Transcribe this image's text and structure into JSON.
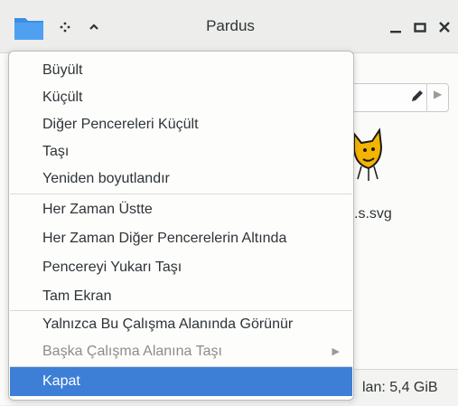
{
  "window": {
    "title": "Pardus"
  },
  "background": {
    "filename_partial": ".s.svg",
    "status_partial": "lan: 5,4 GiB"
  },
  "menu": {
    "items": [
      {
        "label": "Büyült"
      },
      {
        "label": "Küçült"
      },
      {
        "label": "Diğer Pencereleri Küçült"
      },
      {
        "label": "Taşı"
      },
      {
        "label": "Yeniden boyutlandır"
      },
      {
        "label": "Her Zaman Üstte"
      },
      {
        "label": "Her Zaman Diğer Pencerelerin Altında"
      },
      {
        "label": "Pencereyi Yukarı Taşı"
      },
      {
        "label": "Tam Ekran"
      },
      {
        "label": "Yalnızca Bu Çalışma Alanında Görünür"
      },
      {
        "label": "Başka Çalışma Alanına Taşı"
      },
      {
        "label": "Kapat"
      }
    ]
  },
  "colors": {
    "selection": "#3d7fd6",
    "folder_icon": "#3b8ee3"
  }
}
